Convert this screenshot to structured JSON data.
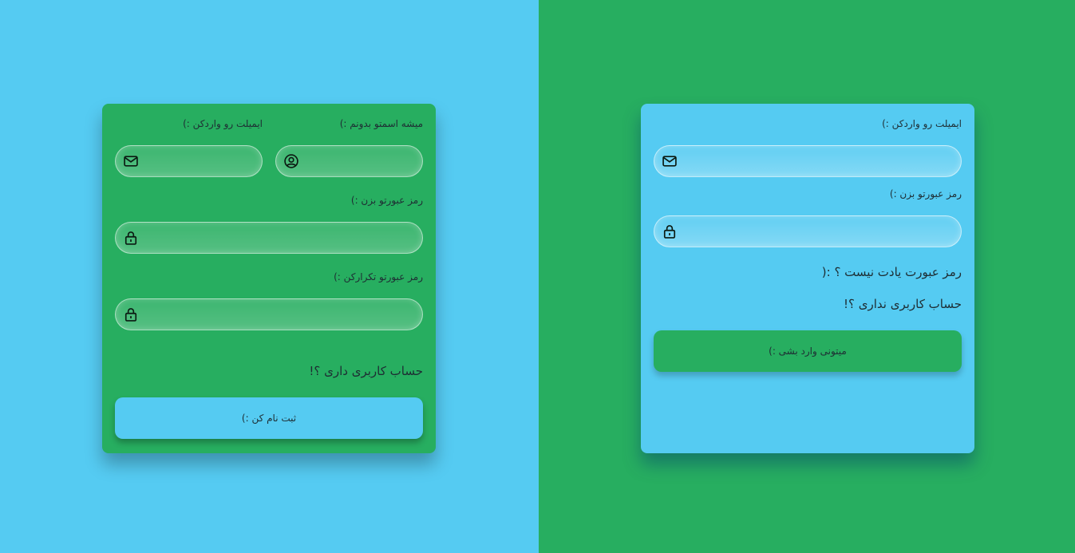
{
  "signup": {
    "name_label": "میشه اسمتو بدونم :)",
    "email_label": "ایمیلت رو واردکن :)",
    "password_label": "رمز عبورتو بزن :)",
    "confirm_label": "رمز عبورتو تکرارکن :)",
    "have_account_link": "حساب کاربری داری ؟!",
    "submit_label": "ثبت نام کن :)",
    "name_value": "",
    "email_value": "",
    "password_value": "",
    "confirm_value": ""
  },
  "login": {
    "email_label": "ایمیلت رو واردکن :)",
    "password_label": "رمز عبورتو بزن :)",
    "forgot_link": "رمز عبورت یادت نیست ؟ :(",
    "no_account_link": "حساب کاربری نداری ؟!",
    "submit_label": "میتونی وارد بشی :)",
    "email_value": "",
    "password_value": ""
  },
  "colors": {
    "blue": "#55cbf2",
    "green": "#27ae60",
    "icon": "#0b1a12"
  },
  "icons": [
    "mail-icon",
    "user-icon",
    "lock-icon"
  ]
}
